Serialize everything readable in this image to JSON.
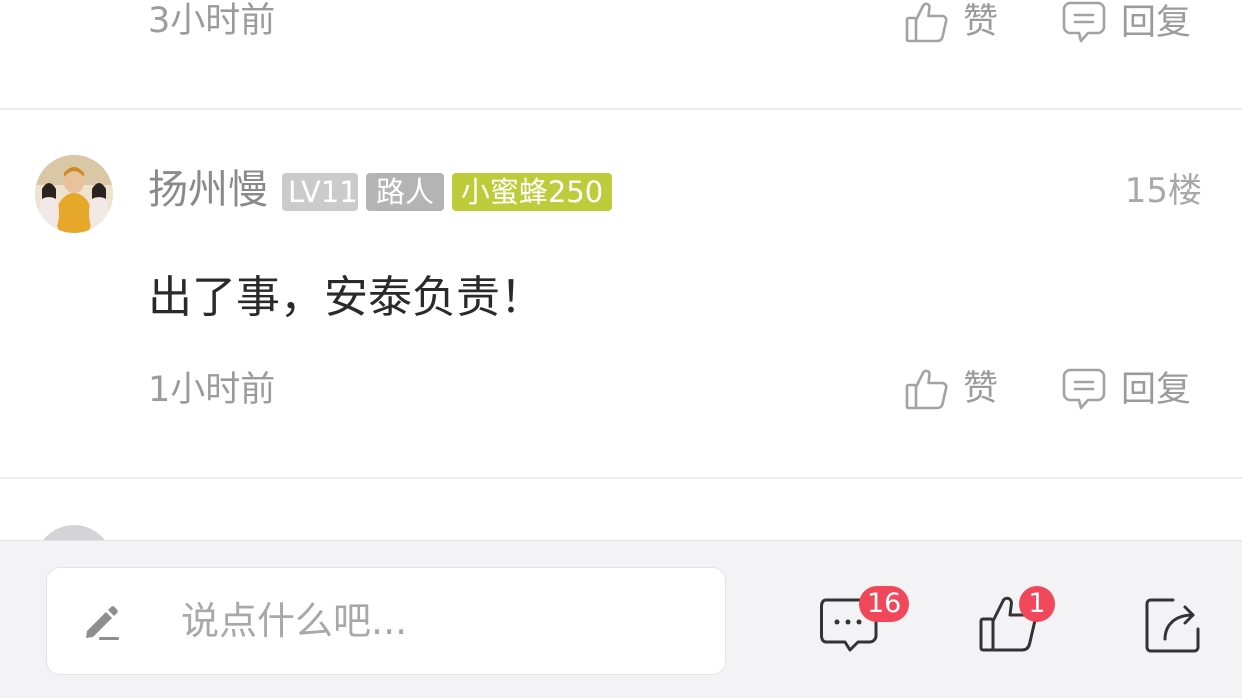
{
  "prev_comment": {
    "time": "3小时前",
    "like_label": "赞",
    "reply_label": "回复"
  },
  "comment": {
    "username": "扬州慢",
    "badges": {
      "level": "LV11",
      "title": "路人",
      "fan": "小蜜蜂250"
    },
    "floor": "15楼",
    "content": "出了事，安泰负责！",
    "time": "1小时前",
    "like_label": "赞",
    "reply_label": "回复"
  },
  "bottom_bar": {
    "input_placeholder": "说点什么吧...",
    "comment_count": "16",
    "like_count": "1"
  },
  "colors": {
    "badge_level": "#cbcbcb",
    "badge_title": "#b4b4b4",
    "badge_fan": "#bccc3a",
    "count_badge": "#f1475a"
  }
}
